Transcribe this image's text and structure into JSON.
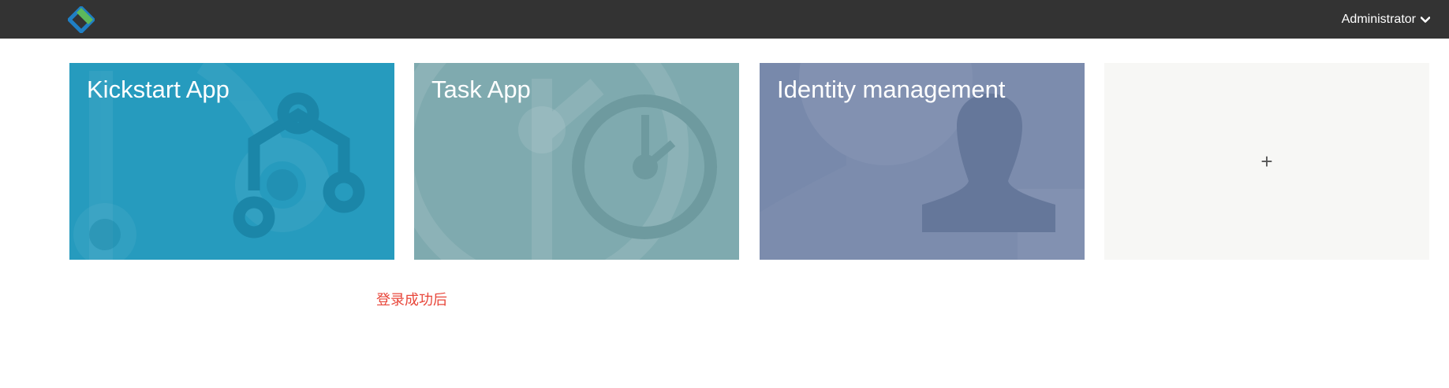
{
  "header": {
    "logo_icon": "flowable-diamond-icon",
    "user_label": "Administrator",
    "user_menu_icon": "chevron-down-icon",
    "bar_color": "#333333"
  },
  "tiles": [
    {
      "title": "Kickstart App",
      "icon": "process-flow-icon",
      "color": "#269bbe"
    },
    {
      "title": "Task App",
      "icon": "clock-icon",
      "color": "#7faaaf"
    },
    {
      "title": "Identity management",
      "icon": "user-silhouette-icon",
      "color": "#7889ab"
    },
    {
      "title": "+",
      "icon": "plus-icon",
      "color": "#f7f7f5"
    }
  ],
  "note": {
    "text": "登录成功后",
    "color": "#e8473b"
  }
}
